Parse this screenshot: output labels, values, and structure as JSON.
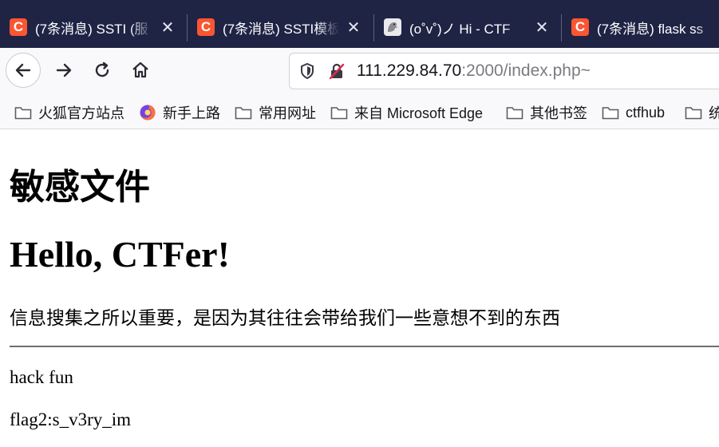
{
  "tabs": [
    {
      "title": "(7条消息) SSTI (服",
      "favicon": "C"
    },
    {
      "title": "(7条消息) SSTI模板",
      "favicon": "C"
    },
    {
      "title": "(o˚v˚)ノ Hi - CTF",
      "favicon": "bird-icon"
    },
    {
      "title": "(7条消息) flask ss",
      "favicon": "C"
    }
  ],
  "tab_close_glyph": "✕",
  "address": {
    "host": "111.229.84.70",
    "rest": ":2000/index.php~"
  },
  "bookmarks": [
    {
      "label": "火狐官方站点",
      "icon": "folder-icon"
    },
    {
      "label": "新手上路",
      "icon": "firefox-icon"
    },
    {
      "label": "常用网址",
      "icon": "folder-icon"
    },
    {
      "label": "来自 Microsoft Edge",
      "icon": "folder-icon"
    },
    {
      "label": "其他书签",
      "icon": "folder-icon"
    },
    {
      "label": "ctfhub",
      "icon": "folder-icon"
    },
    {
      "label": "统",
      "icon": "folder-icon"
    }
  ],
  "page": {
    "heading": "敏感文件",
    "subheading": "Hello, CTFer!",
    "lead": "信息搜集之所以重要，是因为其往往会带给我们一些意想不到的东西",
    "line1": "hack fun",
    "line2": "flag2:s_v3ry_im"
  },
  "colors": {
    "tabstrip": "#1f2445",
    "csdn_brand": "#fc5531",
    "toolbar": "#f9f9fb"
  }
}
